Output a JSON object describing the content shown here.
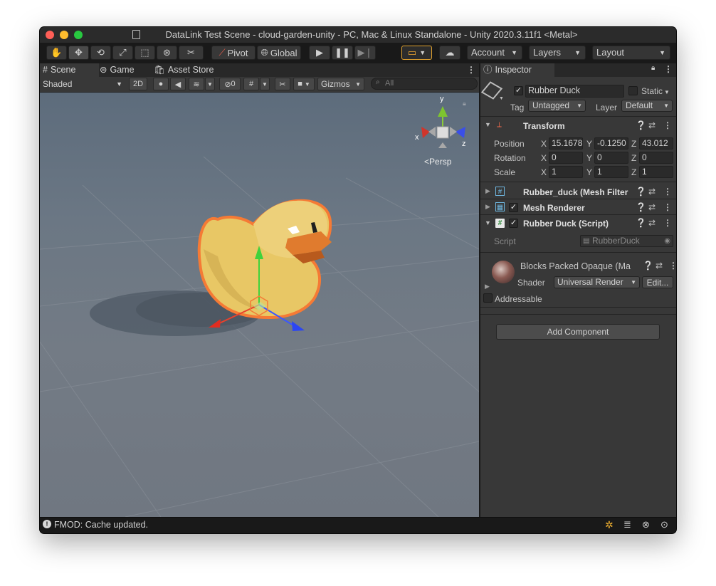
{
  "window": {
    "title": "DataLink Test Scene - cloud-garden-unity - PC, Mac & Linux Standalone - Unity 2020.3.11f1 <Metal>"
  },
  "toolbar": {
    "pivot_label": "Pivot",
    "global_label": "Global",
    "account_label": "Account",
    "layers_label": "Layers",
    "layout_label": "Layout"
  },
  "tabs": {
    "scene": "Scene",
    "game": "Game",
    "asset_store": "Asset Store",
    "inspector": "Inspector"
  },
  "scene_toolbar": {
    "shading_mode": "Shaded",
    "mode_2d": "2D",
    "hidden_count": "0",
    "gizmos": "Gizmos",
    "search_placeholder": "All"
  },
  "viewport": {
    "projection": "Persp",
    "axis_x": "x",
    "axis_y": "y",
    "axis_z": "z"
  },
  "inspector": {
    "object_name": "Rubber Duck",
    "static_label": "Static",
    "tag_label": "Tag",
    "tag_value": "Untagged",
    "layer_label": "Layer",
    "layer_value": "Default",
    "transform": {
      "title": "Transform",
      "position_label": "Position",
      "rotation_label": "Rotation",
      "scale_label": "Scale",
      "position": {
        "x": "15.1678",
        "y": "-0.1250",
        "z": "43.012"
      },
      "rotation": {
        "x": "0",
        "y": "0",
        "z": "0"
      },
      "scale": {
        "x": "1",
        "y": "1",
        "z": "1"
      }
    },
    "mesh_filter_title": "Rubber_duck (Mesh Filter",
    "mesh_renderer_title": "Mesh Renderer",
    "script_component_title": "Rubber Duck (Script)",
    "script_label": "Script",
    "script_value": "RubberDuck",
    "material_name": "Blocks Packed Opaque (Ma",
    "shader_label": "Shader",
    "shader_value": "Universal Render",
    "edit_label": "Edit...",
    "addressable_label": "Addressable",
    "add_component_label": "Add Component"
  },
  "status": {
    "message": "FMOD: Cache updated."
  },
  "colors": {
    "accent_orange": "#f6873a",
    "selection_outline": "#f57a35",
    "duck_yellow": "#e8c765",
    "beak_orange": "#e07b2e"
  }
}
